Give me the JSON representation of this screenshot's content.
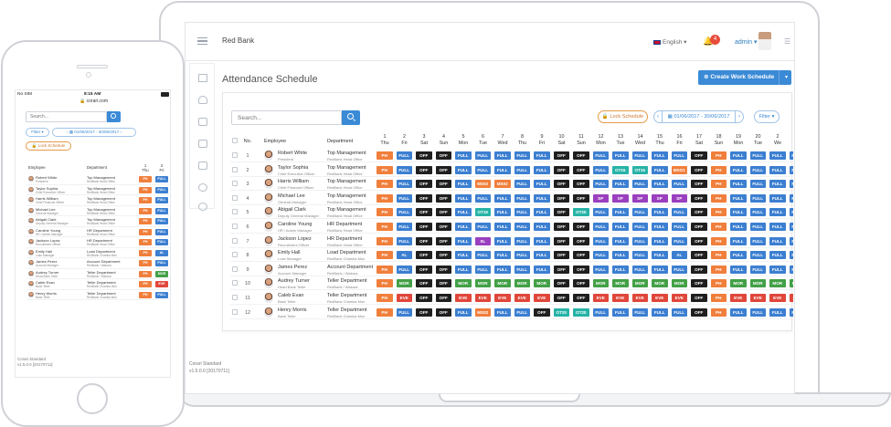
{
  "app": {
    "brand": "Red Bank",
    "language": "English",
    "notifications": "4",
    "user": "admin"
  },
  "page": {
    "title": "Attendance Schedule",
    "create_label": "Create Work Schedule",
    "search_placeholder": "Search...",
    "lock_label": "Lock Schedule",
    "date_range": "01/06/2017 - 30/06/2017",
    "filter_label": "Filter",
    "prev": "‹",
    "next": "›"
  },
  "footer": {
    "line1": "Corari Standard",
    "line2": "v1.5.0.0 [20170711]"
  },
  "columns": {
    "no": "No.",
    "employee": "Employee",
    "department": "Department"
  },
  "days": [
    {
      "d": "1",
      "w": "Thu"
    },
    {
      "d": "2",
      "w": "Fri"
    },
    {
      "d": "3",
      "w": "Sat"
    },
    {
      "d": "4",
      "w": "Sun"
    },
    {
      "d": "5",
      "w": "Mon"
    },
    {
      "d": "6",
      "w": "Tue"
    },
    {
      "d": "7",
      "w": "Wed"
    },
    {
      "d": "8",
      "w": "Thu"
    },
    {
      "d": "9",
      "w": "Fri"
    },
    {
      "d": "10",
      "w": "Sat"
    },
    {
      "d": "11",
      "w": "Sun"
    },
    {
      "d": "12",
      "w": "Mon"
    },
    {
      "d": "13",
      "w": "Tue"
    },
    {
      "d": "14",
      "w": "Wed"
    },
    {
      "d": "15",
      "w": "Thu"
    },
    {
      "d": "16",
      "w": "Fri"
    },
    {
      "d": "17",
      "w": "Sat"
    },
    {
      "d": "18",
      "w": "Sun"
    },
    {
      "d": "19",
      "w": "Mon"
    },
    {
      "d": "20",
      "w": "Tue"
    },
    {
      "d": "2",
      "w": "We"
    },
    {
      "d": "2",
      "w": "Th"
    }
  ],
  "status_colors": {
    "PH": "#f07f3c",
    "FULL": "#3c7fd1",
    "OFF": "#1f1f1f",
    "MS02": "#f07f3c",
    "MSO1": "#f07f3c",
    "OT15": "#27b3a7",
    "OT20": "#27b3a7",
    "OT25": "#27b3a7",
    "SL": "#9a3fbf",
    "SP": "#9a3fbf",
    "AL": "#3c7fd1",
    "MOR": "#43a047",
    "EVE": "#e0463a"
  },
  "employees": [
    {
      "no": "1",
      "name": "Robert White",
      "role": "President",
      "dept": "Top Management",
      "sub": "RedBank Head Office",
      "cells": [
        "PH",
        "FULL",
        "OFF",
        "OFF",
        "FULL",
        "FULL",
        "FULL",
        "FULL",
        "FULL",
        "OFF",
        "OFF",
        "FULL",
        "FULL",
        "FULL",
        "FULL",
        "FULL",
        "OFF",
        "PH",
        "FULL",
        "FULL",
        "FULL",
        "FULL"
      ]
    },
    {
      "no": "2",
      "name": "Taylor Sophia",
      "role": "Chief Executive Officer",
      "dept": "Top Management",
      "sub": "RedBank Head Office",
      "cells": [
        "PH",
        "FULL",
        "OFF",
        "OFF",
        "FULL",
        "FULL",
        "FULL",
        "FULL",
        "FULL",
        "OFF",
        "OFF",
        "FULL",
        "OT15",
        "OT15",
        "FULL",
        "MSO1",
        "OFF",
        "PH",
        "FULL",
        "FULL",
        "FULL",
        "FULL"
      ]
    },
    {
      "no": "3",
      "name": "Harris William",
      "role": "Chief Financial Officer",
      "dept": "Top Management",
      "sub": "RedBank Head Office",
      "cells": [
        "PH",
        "FULL",
        "OFF",
        "OFF",
        "FULL",
        "MS02",
        "MS02",
        "FULL",
        "FULL",
        "OFF",
        "OFF",
        "FULL",
        "FULL",
        "FULL",
        "FULL",
        "FULL",
        "OFF",
        "PH",
        "FULL",
        "FULL",
        "FULL",
        "FULL"
      ]
    },
    {
      "no": "4",
      "name": "Michael Lee",
      "role": "General Manager",
      "dept": "Top Management",
      "sub": "RedBank Head Office",
      "cells": [
        "PH",
        "FULL",
        "OFF",
        "OFF",
        "FULL",
        "FULL",
        "FULL",
        "FULL",
        "FULL",
        "OFF",
        "OFF",
        "SP",
        "SP",
        "SP",
        "SP",
        "SP",
        "OFF",
        "PH",
        "FULL",
        "FULL",
        "FULL",
        "FULL"
      ]
    },
    {
      "no": "5",
      "name": "Abigail Clark",
      "role": "Deputy General Manager",
      "dept": "Top Management",
      "sub": "RedBank Head Office",
      "cells": [
        "PH",
        "FULL",
        "OFF",
        "OFF",
        "FULL",
        "OT15",
        "FULL",
        "FULL",
        "FULL",
        "OFF",
        "OT20",
        "FULL",
        "FULL",
        "FULL",
        "FULL",
        "FULL",
        "OFF",
        "PH",
        "FULL",
        "FULL",
        "FULL",
        "FULL"
      ]
    },
    {
      "no": "6",
      "name": "Caroline Young",
      "role": "HR / Admin Manager",
      "dept": "HR Department",
      "sub": "RedBank Head Office",
      "cells": [
        "PH",
        "FULL",
        "OFF",
        "OFF",
        "FULL",
        "FULL",
        "FULL",
        "FULL",
        "FULL",
        "OFF",
        "OFF",
        "FULL",
        "FULL",
        "FULL",
        "FULL",
        "FULL",
        "OFF",
        "PH",
        "FULL",
        "FULL",
        "FULL",
        "FULL"
      ]
    },
    {
      "no": "7",
      "name": "Jackson Lopez",
      "role": "Recruitment Officer",
      "dept": "HR Department",
      "sub": "RedBank Head Office",
      "cells": [
        "PH",
        "FULL",
        "OFF",
        "OFF",
        "FULL",
        "SL",
        "FULL",
        "FULL",
        "FULL",
        "OFF",
        "OFF",
        "FULL",
        "FULL",
        "FULL",
        "FULL",
        "FULL",
        "OFF",
        "PH",
        "FULL",
        "FULL",
        "FULL",
        "FULL"
      ]
    },
    {
      "no": "8",
      "name": "Emily Hall",
      "role": "Loan Manager",
      "dept": "Load Department",
      "sub": "RedBank Chamka Mon",
      "cells": [
        "PH",
        "AL",
        "OFF",
        "OFF",
        "FULL",
        "FULL",
        "FULL",
        "FULL",
        "FULL",
        "OFF",
        "OFF",
        "FULL",
        "FULL",
        "FULL",
        "FULL",
        "AL",
        "OFF",
        "PH",
        "FULL",
        "FULL",
        "FULL",
        "FULL"
      ]
    },
    {
      "no": "9",
      "name": "James Perez",
      "role": "Account Manager",
      "dept": "Account Department",
      "sub": "RedBank / Wakara",
      "cells": [
        "PH",
        "FULL",
        "OFF",
        "OFF",
        "FULL",
        "FULL",
        "FULL",
        "FULL",
        "FULL",
        "OFF",
        "OFF",
        "FULL",
        "FULL",
        "FULL",
        "FULL",
        "FULL",
        "OFF",
        "PH",
        "FULL",
        "FULL",
        "FULL",
        "FULL"
      ]
    },
    {
      "no": "10",
      "name": "Audrey Turner",
      "role": "Head Bank Teller",
      "dept": "Teller Department",
      "sub": "RedBank / Wakara",
      "cells": [
        "PH",
        "MOR",
        "OFF",
        "OFF",
        "MOR",
        "MOR",
        "MOR",
        "MOR",
        "MOR",
        "OFF",
        "OFF",
        "MOR",
        "MOR",
        "MOR",
        "MOR",
        "MOR",
        "OFF",
        "PH",
        "MOR",
        "MOR",
        "MOR",
        "MOR"
      ]
    },
    {
      "no": "11",
      "name": "Caleb Evan",
      "role": "Bank Teller",
      "dept": "Teller Department",
      "sub": "RedBank Chamka Mon",
      "cells": [
        "PH",
        "EVE",
        "OFF",
        "OFF",
        "EVE",
        "EVE",
        "EVE",
        "EVE",
        "EVE",
        "OFF",
        "OFF",
        "EVE",
        "EVE",
        "EVE",
        "EVE",
        "EVE",
        "OFF",
        "PH",
        "EVE",
        "EVE",
        "EVE",
        "EVE"
      ]
    },
    {
      "no": "12",
      "name": "Henry Morris",
      "role": "Bank Teller",
      "dept": "Teller Department",
      "sub": "RedBank Chamka Mon",
      "cells": [
        "PH",
        "FULL",
        "OFF",
        "OFF",
        "FULL",
        "MS02",
        "FULL",
        "FULL",
        "OFF",
        "OT20",
        "OT20",
        "FULL",
        "FULL",
        "FULL",
        "FULL",
        "FULL",
        "OFF",
        "PH",
        "FULL",
        "FULL",
        "FULL",
        "FULL"
      ]
    }
  ],
  "mobile": {
    "carrier": "No SIM",
    "time": "8:15 AM",
    "url": "corari.com",
    "search_placeholder": "Search...",
    "filter_label": "Filter",
    "date_range": "01/06/2017 - 30/06/2017",
    "lock_label": "Lock Schedule",
    "employee_header": "Employee",
    "department_header": "Department",
    "days": [
      {
        "d": "1",
        "w": "Thu"
      },
      {
        "d": "2",
        "w": "Fri"
      }
    ],
    "footer1": "Corari Standard",
    "footer2": "v1.5.0.0 [20170711]",
    "rows": [
      {
        "name": "Robert White",
        "role": "President",
        "dept": "Top Management",
        "sub": "RedBank Head Office",
        "cells": [
          "PH",
          "FULL"
        ]
      },
      {
        "name": "Taylor Sophia",
        "role": "Chief Executive Officer",
        "dept": "Top Management",
        "sub": "RedBank Head Office",
        "cells": [
          "PH",
          "FULL"
        ]
      },
      {
        "name": "Harris William",
        "role": "Chief Financial Officer",
        "dept": "Top Management",
        "sub": "RedBank Head Office",
        "cells": [
          "PH",
          "FULL"
        ]
      },
      {
        "name": "Michael Lee",
        "role": "General Manager",
        "dept": "Top Management",
        "sub": "RedBank Head Office",
        "cells": [
          "PH",
          "FULL"
        ]
      },
      {
        "name": "Abigail Clark",
        "role": "Deputy General Manager",
        "dept": "Top Management",
        "sub": "RedBank Head Office",
        "cells": [
          "PH",
          "FULL"
        ]
      },
      {
        "name": "Caroline Young",
        "role": "HR / Admin Manager",
        "dept": "HR Department",
        "sub": "RedBank Head Office",
        "cells": [
          "PH",
          "FULL"
        ]
      },
      {
        "name": "Jackson Lopez",
        "role": "Recruitment Officer",
        "dept": "HR Department",
        "sub": "RedBank Head Office",
        "cells": [
          "PH",
          "FULL"
        ]
      },
      {
        "name": "Emily Hall",
        "role": "Loan Manager",
        "dept": "Load Department",
        "sub": "RedBank Chamka Mon",
        "cells": [
          "PH",
          "AL"
        ]
      },
      {
        "name": "James Perez",
        "role": "Account Manager",
        "dept": "Account Department",
        "sub": "RedBank / Wakara",
        "cells": [
          "PH",
          "FULL"
        ]
      },
      {
        "name": "Audrey Turner",
        "role": "Head Bank Teller",
        "dept": "Teller Department",
        "sub": "RedBank / Wakara",
        "cells": [
          "PH",
          "MOR"
        ]
      },
      {
        "name": "Caleb Evan",
        "role": "Bank Teller",
        "dept": "Teller Department",
        "sub": "RedBank Chamka Mon",
        "cells": [
          "PH",
          "EVE"
        ]
      },
      {
        "name": "Henry Morris",
        "role": "Bank Teller",
        "dept": "Teller Department",
        "sub": "RedBank Chamka Mon",
        "cells": [
          "PH",
          "FULL"
        ]
      }
    ]
  }
}
